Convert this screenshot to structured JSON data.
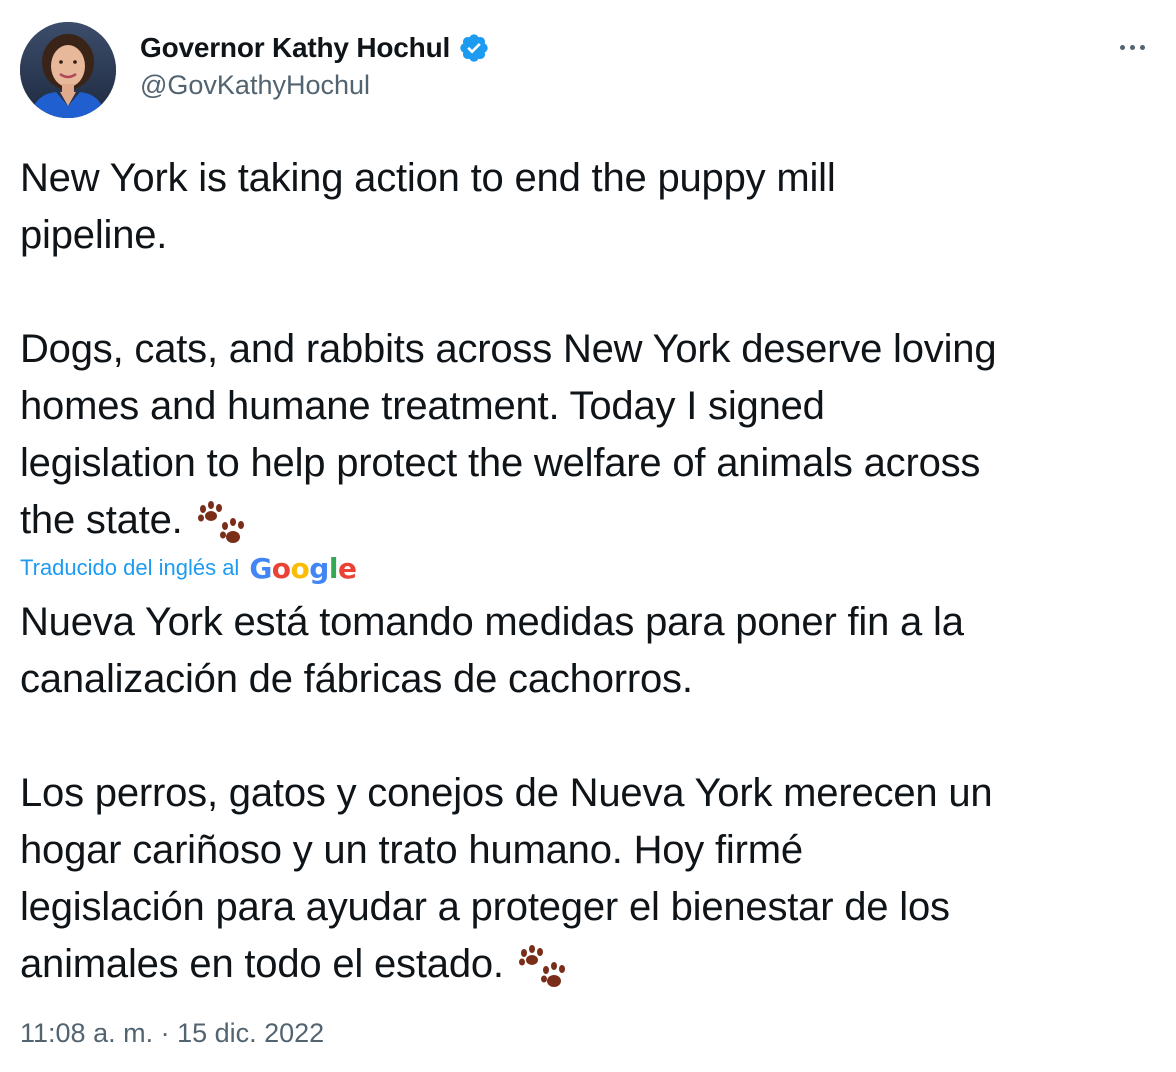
{
  "author": {
    "display_name": "Governor Kathy Hochul",
    "handle": "@GovKathyHochul",
    "verified": true,
    "avatar_icon": "profile-photo"
  },
  "tweet": {
    "line1": "New York is taking action to end the puppy mill",
    "line2": "pipeline.",
    "line3": "Dogs, cats, and rabbits across New York deserve loving",
    "line4": "homes and humane treatment. Today I signed",
    "line5": "legislation to help protect the welfare of animals across",
    "line6": "the state.",
    "emoji_icon": "paw-prints-icon"
  },
  "translation": {
    "label": "Traducido del inglés al",
    "provider": "Google",
    "line1": "Nueva York está tomando medidas para poner fin a la",
    "line2": "canalización de fábricas de cachorros.",
    "line3": "Los perros, gatos y conejos de Nueva York merecen un",
    "line4": "hogar cariñoso y un trato humano. Hoy firmé",
    "line5": "legislación para ayudar a proteger el bienestar de los",
    "line6": "animales en todo el estado."
  },
  "meta": {
    "timestamp": "11:08 a. m. · 15 dic. 2022"
  },
  "colors": {
    "text": "#0f1419",
    "secondary": "#536471",
    "accent": "#1d9bf0",
    "paw": "#7a2e1a"
  }
}
